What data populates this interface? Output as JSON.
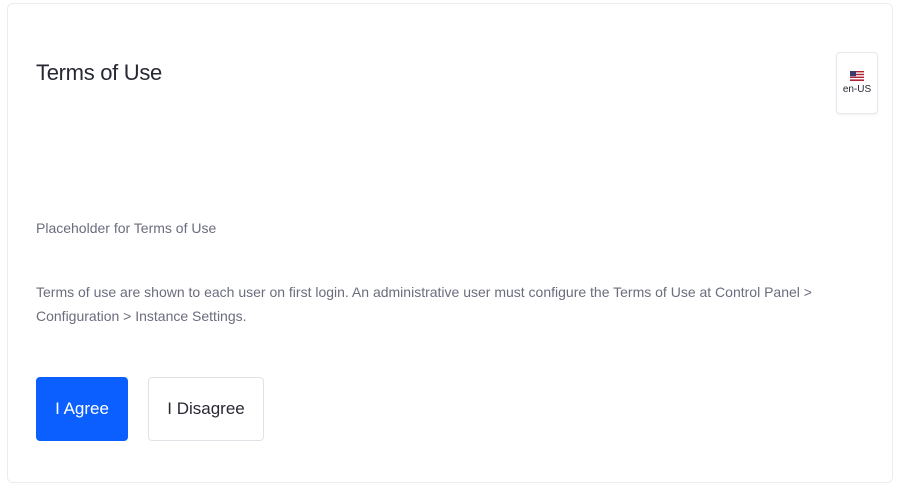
{
  "card": {
    "title": "Terms of Use",
    "language": {
      "label": "en-US",
      "icon": "us-flag-icon"
    },
    "placeholder_text": "Placeholder for Terms of Use",
    "description": "Terms of use are shown to each user on first login. An administrative user must configure the Terms of Use at Control Panel > Configuration > Instance Settings.",
    "buttons": {
      "agree_label": "I Agree",
      "disagree_label": "I Disagree"
    }
  },
  "colors": {
    "primary": "#0b5fff",
    "text_primary": "#272833",
    "text_secondary": "#6b6c7e",
    "border": "#e7e7ed"
  }
}
